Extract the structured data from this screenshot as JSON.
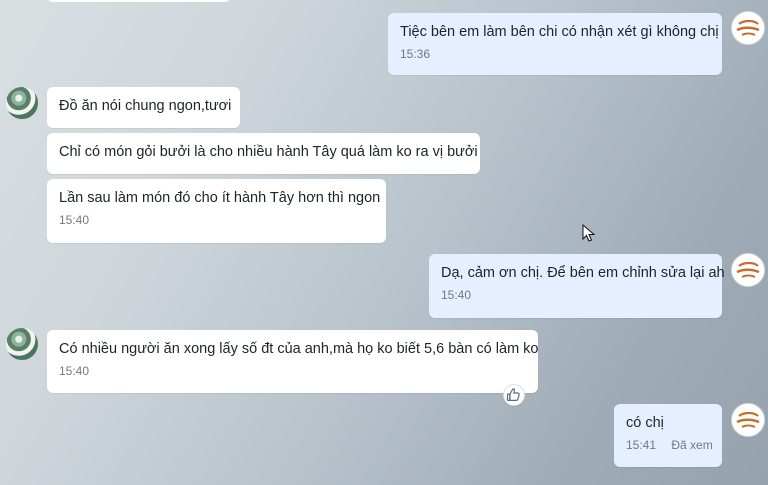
{
  "messages": {
    "m1": {
      "text": "Tiệc bên em làm bên chi có nhận xét gì không chị",
      "time": "15:36"
    },
    "m2": {
      "text": "Đồ ăn nói chung ngon,tươi"
    },
    "m3": {
      "text": "Chỉ có món gỏi bưởi là cho nhiều hành Tây quá làm ko ra vị bưởi"
    },
    "m4": {
      "text": "Lần sau làm món đó cho ít hành Tây hơn thì ngon",
      "time": "15:40"
    },
    "m5": {
      "text": "Dạ, cảm ơn chị. Để bên em chỉnh sửa lại ah",
      "time": "15:40"
    },
    "m6": {
      "text": "Có nhiều người ăn xong lấy số đt của anh,mà họ ko biết 5,6 bàn có làm ko",
      "time": "15:40"
    },
    "m7": {
      "text": "có chị",
      "time": "15:41",
      "status": "Đã xem"
    }
  },
  "icons": {
    "brand_avatar": "brand-logo-avatar",
    "user_avatar": "user-avatar",
    "reaction": "thumbs-up-icon",
    "cursor": "mouse-pointer-icon"
  },
  "colors": {
    "incoming_bubble": "#ffffff",
    "outgoing_bubble": "#e5efff",
    "brand_accent": "#c56d2a"
  }
}
